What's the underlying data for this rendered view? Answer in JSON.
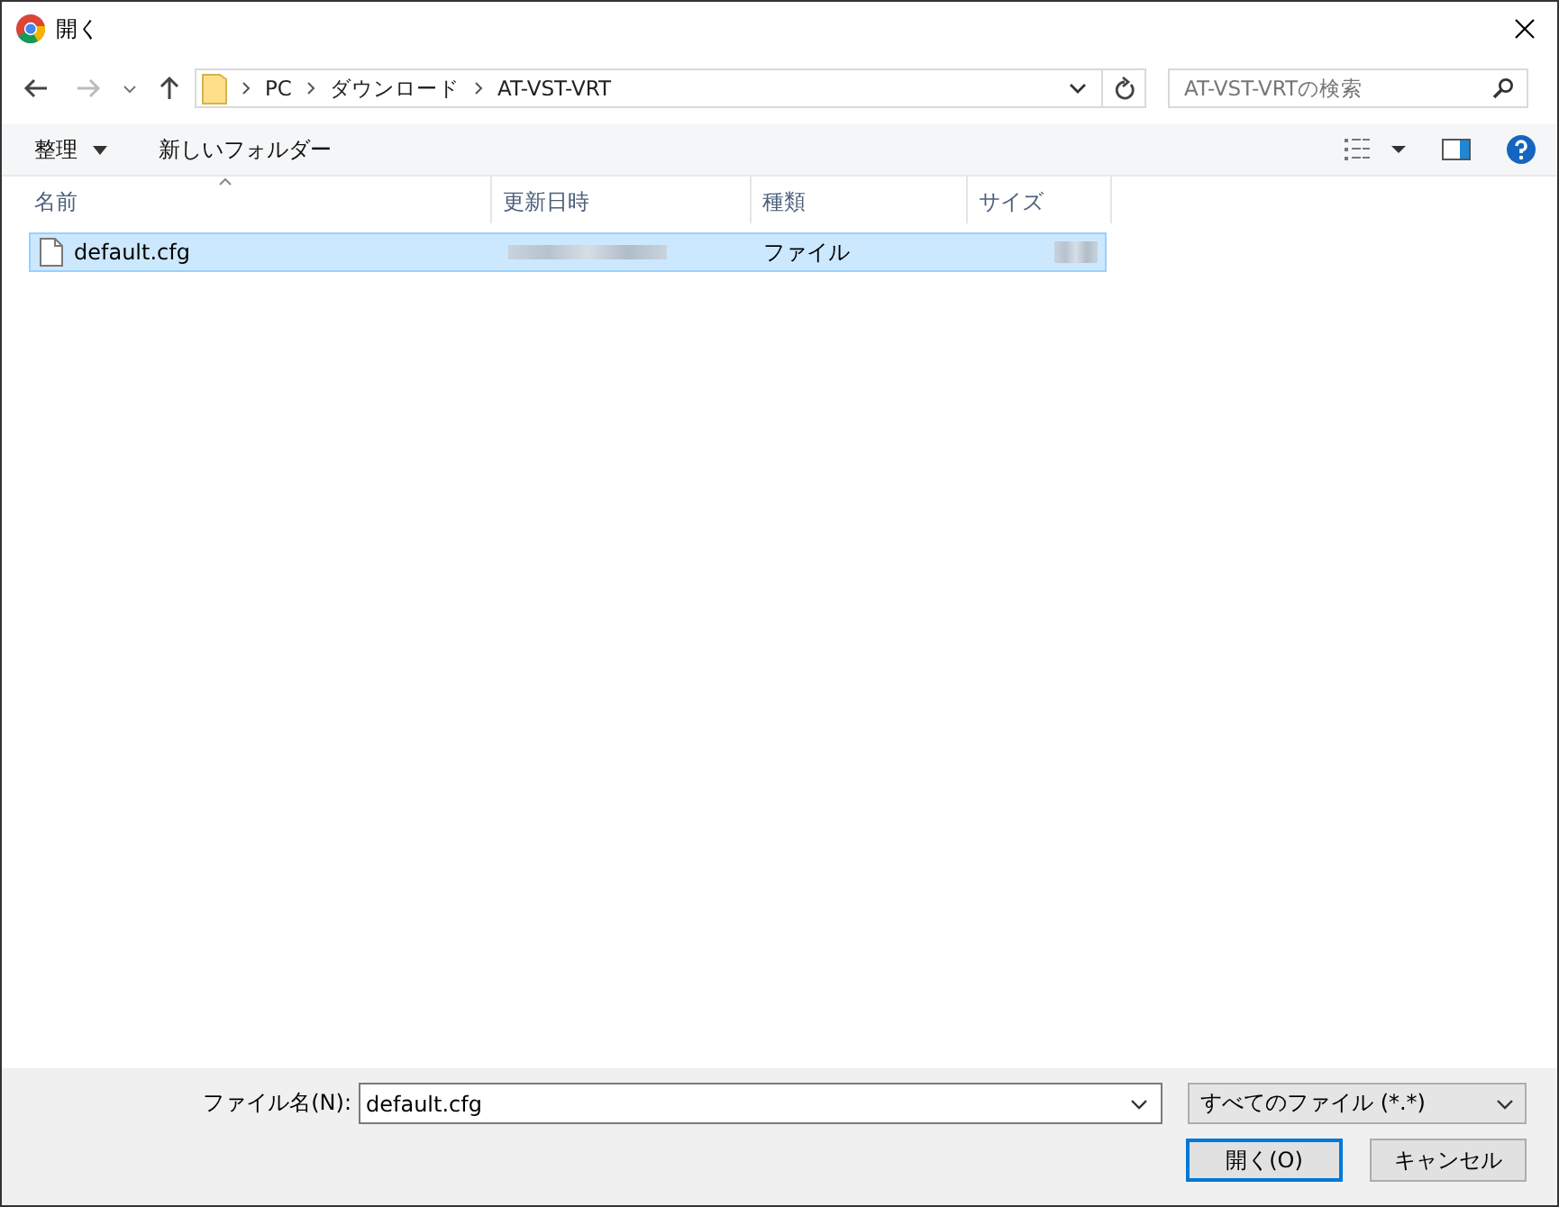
{
  "window": {
    "title": "開く"
  },
  "address": {
    "path": [
      {
        "label": "PC"
      },
      {
        "label": "ダウンロード"
      },
      {
        "label": "AT-VST-VRT"
      }
    ]
  },
  "search": {
    "placeholder": "AT-VST-VRTの検索"
  },
  "toolbar": {
    "organize": "整理",
    "new_folder": "新しいフォルダー"
  },
  "columns": [
    {
      "label": "名前",
      "sorted": true
    },
    {
      "label": "更新日時",
      "sorted": false
    },
    {
      "label": "種類",
      "sorted": false
    },
    {
      "label": "サイズ",
      "sorted": false
    }
  ],
  "rows": [
    {
      "name": "default.cfg",
      "type": "ファイル",
      "selected": true
    }
  ],
  "footer": {
    "filename_label": "ファイル名(N):",
    "filename": "default.cfg",
    "filter": "すべてのファイル (*.*)",
    "open": "開く(O)",
    "cancel": "キャンセル"
  }
}
